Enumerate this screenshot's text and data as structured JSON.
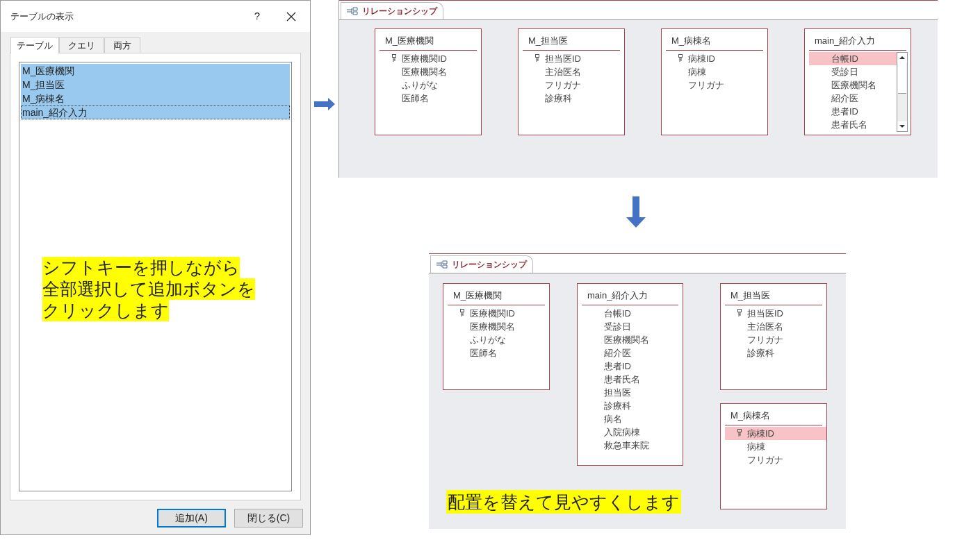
{
  "dialog": {
    "title": "テーブルの表示",
    "help": "?",
    "tabs": [
      {
        "label": "テーブル",
        "selected": true
      },
      {
        "label": "クエリ",
        "selected": false
      },
      {
        "label": "両方",
        "selected": false
      }
    ],
    "list_items": [
      {
        "label": "M_医療機関",
        "selected": true,
        "focused": false
      },
      {
        "label": "M_担当医",
        "selected": true,
        "focused": false
      },
      {
        "label": "M_病棟名",
        "selected": true,
        "focused": false
      },
      {
        "label": "main_紹介入力",
        "selected": true,
        "focused": true
      }
    ],
    "note_lines": [
      "シフトキーを押しながら",
      "全部選択して追加ボタンを",
      "クリックします"
    ],
    "buttons": [
      {
        "label": "追加(A)",
        "default": true
      },
      {
        "label": "閉じる(C)",
        "default": false
      }
    ]
  },
  "panels": [
    {
      "tab_label": "リレーションシップ",
      "tables": [
        {
          "name": "M_医療機関",
          "scrollbar": false,
          "fields": [
            {
              "name": "医療機関ID",
              "primary_key": true,
              "selected": false
            },
            {
              "name": "医療機関名",
              "primary_key": false,
              "selected": false
            },
            {
              "name": "ふりがな",
              "primary_key": false,
              "selected": false
            },
            {
              "name": "医師名",
              "primary_key": false,
              "selected": false
            }
          ]
        },
        {
          "name": "M_担当医",
          "scrollbar": false,
          "fields": [
            {
              "name": "担当医ID",
              "primary_key": true,
              "selected": false
            },
            {
              "name": "主治医名",
              "primary_key": false,
              "selected": false
            },
            {
              "name": "フリガナ",
              "primary_key": false,
              "selected": false
            },
            {
              "name": "診療科",
              "primary_key": false,
              "selected": false
            }
          ]
        },
        {
          "name": "M_病棟名",
          "scrollbar": false,
          "fields": [
            {
              "name": "病棟ID",
              "primary_key": true,
              "selected": false
            },
            {
              "name": "病棟",
              "primary_key": false,
              "selected": false
            },
            {
              "name": "フリガナ",
              "primary_key": false,
              "selected": false
            }
          ]
        },
        {
          "name": "main_紹介入力",
          "scrollbar": true,
          "fields": [
            {
              "name": "台帳ID",
              "primary_key": false,
              "selected": true
            },
            {
              "name": "受診日",
              "primary_key": false,
              "selected": false
            },
            {
              "name": "医療機関名",
              "primary_key": false,
              "selected": false
            },
            {
              "name": "紹介医",
              "primary_key": false,
              "selected": false
            },
            {
              "name": "患者ID",
              "primary_key": false,
              "selected": false
            },
            {
              "name": "患者氏名",
              "primary_key": false,
              "selected": false
            }
          ]
        }
      ]
    },
    {
      "tab_label": "リレーションシップ",
      "note": "配置を替えて見やすくします",
      "tables": [
        {
          "name": "M_医療機関",
          "scrollbar": false,
          "fields": [
            {
              "name": "医療機関ID",
              "primary_key": true,
              "selected": false
            },
            {
              "name": "医療機関名",
              "primary_key": false,
              "selected": false
            },
            {
              "name": "ふりがな",
              "primary_key": false,
              "selected": false
            },
            {
              "name": "医師名",
              "primary_key": false,
              "selected": false
            }
          ]
        },
        {
          "name": "main_紹介入力",
          "scrollbar": false,
          "fields": [
            {
              "name": "台帳ID",
              "primary_key": false,
              "selected": false
            },
            {
              "name": "受診日",
              "primary_key": false,
              "selected": false
            },
            {
              "name": "医療機関名",
              "primary_key": false,
              "selected": false
            },
            {
              "name": "紹介医",
              "primary_key": false,
              "selected": false
            },
            {
              "name": "患者ID",
              "primary_key": false,
              "selected": false
            },
            {
              "name": "患者氏名",
              "primary_key": false,
              "selected": false
            },
            {
              "name": "担当医",
              "primary_key": false,
              "selected": false
            },
            {
              "name": "診療科",
              "primary_key": false,
              "selected": false
            },
            {
              "name": "病名",
              "primary_key": false,
              "selected": false
            },
            {
              "name": "入院病棟",
              "primary_key": false,
              "selected": false
            },
            {
              "name": "救急車来院",
              "primary_key": false,
              "selected": false
            }
          ]
        },
        {
          "name": "M_担当医",
          "scrollbar": false,
          "fields": [
            {
              "name": "担当医ID",
              "primary_key": true,
              "selected": false
            },
            {
              "name": "主治医名",
              "primary_key": false,
              "selected": false
            },
            {
              "name": "フリガナ",
              "primary_key": false,
              "selected": false
            },
            {
              "name": "診療科",
              "primary_key": false,
              "selected": false
            }
          ]
        },
        {
          "name": "M_病棟名",
          "scrollbar": false,
          "fields": [
            {
              "name": "病棟ID",
              "primary_key": true,
              "selected": true
            },
            {
              "name": "病棟",
              "primary_key": false,
              "selected": false
            },
            {
              "name": "フリガナ",
              "primary_key": false,
              "selected": false
            }
          ]
        }
      ]
    }
  ]
}
